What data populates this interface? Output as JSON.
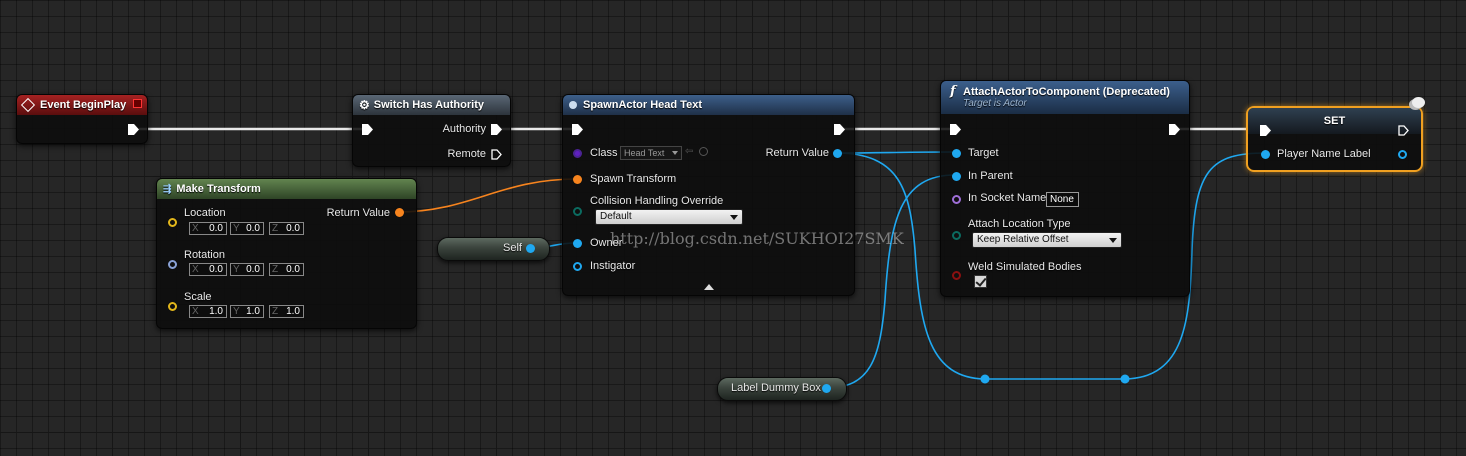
{
  "nodes": {
    "event_begin_play": {
      "title": "Event BeginPlay"
    },
    "switch_authority": {
      "title": "Switch Has Authority",
      "pins": {
        "authority": "Authority",
        "remote": "Remote"
      }
    },
    "make_transform": {
      "title": "Make Transform",
      "pins": {
        "location": "Location",
        "rotation": "Rotation",
        "scale": "Scale",
        "return_value": "Return Value"
      },
      "location": {
        "x": "0.0",
        "y": "0.0",
        "z": "0.0"
      },
      "rotation": {
        "x": "0.0",
        "y": "0.0",
        "z": "0.0"
      },
      "scale": {
        "x": "1.0",
        "y": "1.0",
        "z": "1.0"
      },
      "axis_labels": {
        "x": "X",
        "y": "Y",
        "z": "Z"
      }
    },
    "spawn_actor": {
      "title": "SpawnActor Head Text",
      "pins": {
        "class": "Class",
        "spawn_transform": "Spawn Transform",
        "collision": "Collision Handling Override",
        "owner": "Owner",
        "instigator": "Instigator",
        "return_value": "Return Value"
      },
      "class_value": "Head Text",
      "collision_value": "Default"
    },
    "attach_actor": {
      "title": "AttachActorToComponent (Deprecated)",
      "subtitle": "Target is Actor",
      "pins": {
        "target": "Target",
        "in_parent": "In Parent",
        "in_socket_name": "In Socket Name",
        "attach_location_type": "Attach Location Type",
        "weld": "Weld Simulated Bodies"
      },
      "socket_value": "None",
      "location_type_value": "Keep Relative Offset",
      "weld_checked": true
    },
    "set_node": {
      "title": "SET",
      "pin_label": "Player Name Label"
    },
    "self_node": {
      "label": "Self"
    },
    "label_dummy_box": {
      "label": "Label Dummy Box"
    }
  },
  "watermark": "http://blog.csdn.net/SUKHOI27SMK",
  "colors": {
    "event_header": "#8c1a1a",
    "function_header": "#2c4b73",
    "make_header": "#4b6d3f",
    "switch_header": "#3f4a57",
    "exec": "#ffffff",
    "object_pin": "#1fa8f0",
    "transform_pin": "#f7841e",
    "vector_pin": "#e3b71b",
    "select_border": "#f0a020"
  }
}
